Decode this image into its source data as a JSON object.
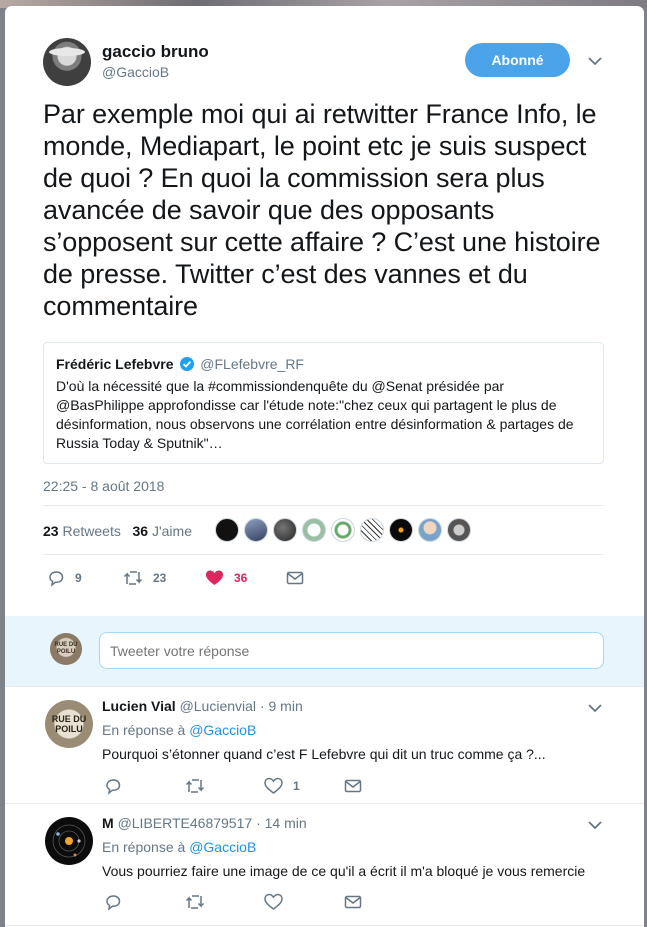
{
  "tweet": {
    "author_name": "gaccio bruno",
    "author_handle": "@GaccioB",
    "follow_label": "Abonné",
    "text": "Par exemple moi qui ai retwitter France Info, le monde, Mediapart, le point etc je suis suspect de quoi ? En quoi la commission sera plus avancée de savoir que des opposants s’opposent sur cette affaire ? C’est une histoire de presse. Twitter c’est des vannes et du commentaire",
    "timestamp": "22:25 - 8 août 2018",
    "retweets_count": "23",
    "retweets_label": "Retweets",
    "likes_count": "36",
    "likes_label": "J'aime",
    "actions": {
      "reply_count": "9",
      "retweet_count": "23",
      "like_count": "36"
    }
  },
  "quoted_tweet": {
    "author_name": "Frédéric Lefebvre",
    "author_handle": "@FLefebvre_RF",
    "text": "D'où la nécessité que la #commissiondenquête du @Senat présidée par @BasPhilippe approfondisse car l'étude note:\"chez ceux qui partagent le plus de désinformation, nous observons une corrélation entre désinformation & partages de Russia Today & Sputnik\"…"
  },
  "reply_box": {
    "placeholder": "Tweeter votre réponse",
    "avatar_text": "RUE DU POILU"
  },
  "replies": [
    {
      "name": "Lucien Vial",
      "handle": "@Lucienvial",
      "time": "9 min",
      "in_reply_prefix": "En réponse à",
      "in_reply_handle": "@GaccioB",
      "text": "Pourquoi s’étonner quand c’est F Lefebvre qui dit un truc comme ça ?...",
      "avatar_text": "RUE DU POILU",
      "reply_count": "",
      "retweet_count": "",
      "like_count": "1"
    },
    {
      "name": "M",
      "handle": "@LIBERTE46879517",
      "time": "14 min",
      "in_reply_prefix": "En réponse à",
      "in_reply_handle": "@GaccioB",
      "text": "Vous pourriez faire une image de ce qu'il a écrit il m'a bloqué je vous remercie",
      "reply_count": "",
      "retweet_count": "",
      "like_count": ""
    }
  ],
  "colors": {
    "accent": "#1b95e0",
    "follow_button": "#4ba3e9",
    "like": "#e0245e",
    "muted": "#657786"
  },
  "icons": [
    "verified-badge-icon",
    "reply-icon",
    "retweet-icon",
    "heart-icon",
    "envelope-icon",
    "chevron-down-icon"
  ]
}
